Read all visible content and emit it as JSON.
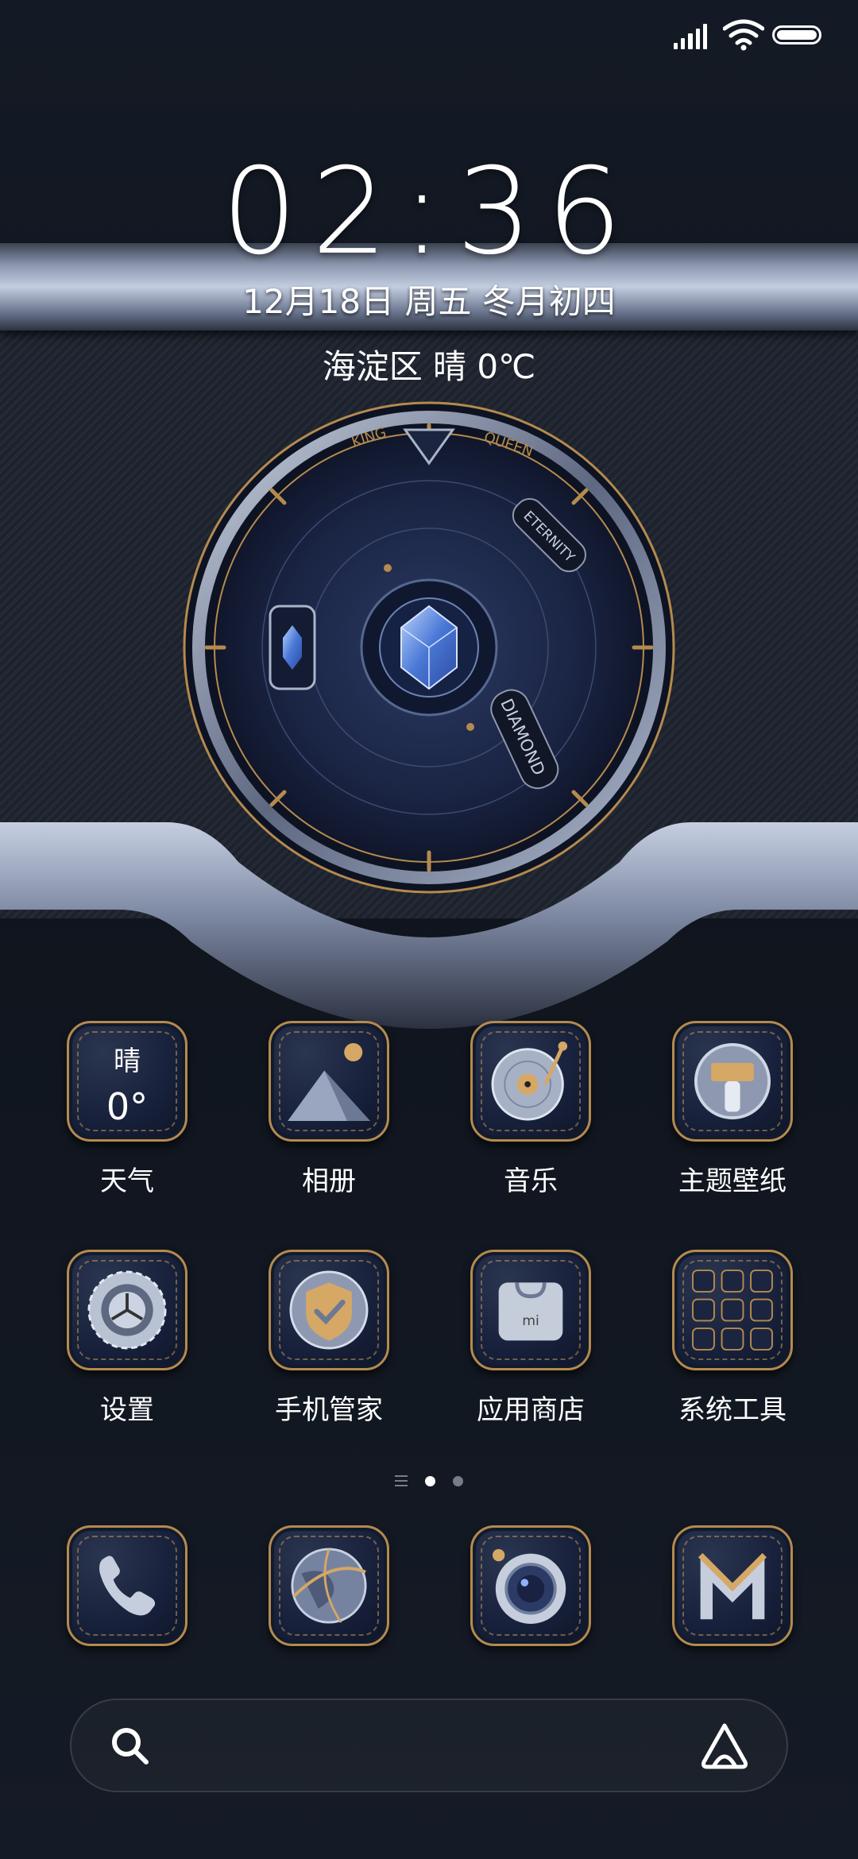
{
  "clock": {
    "time": "02:36"
  },
  "date_line": "12月18日 周五 冬月初四",
  "weather_line": "海淀区  晴  0℃",
  "dial": {
    "labels": [
      "KING",
      "QUEEN",
      "ETERNITY",
      "DIAMOND"
    ]
  },
  "apps": [
    {
      "name": "天气",
      "icon": "weather-icon",
      "text_top": "晴",
      "text_bottom": "0°"
    },
    {
      "name": "相册",
      "icon": "gallery-icon"
    },
    {
      "name": "音乐",
      "icon": "music-icon"
    },
    {
      "name": "主题壁纸",
      "icon": "themes-icon"
    },
    {
      "name": "设置",
      "icon": "settings-icon"
    },
    {
      "name": "手机管家",
      "icon": "security-icon"
    },
    {
      "name": "应用商店",
      "icon": "app-store-icon"
    },
    {
      "name": "系统工具",
      "icon": "system-tools-folder-icon"
    }
  ],
  "page_indicator": {
    "pages": 2,
    "current": 1
  },
  "dock": [
    {
      "icon": "phone-icon"
    },
    {
      "icon": "browser-icon"
    },
    {
      "icon": "camera-icon"
    },
    {
      "icon": "mail-icon"
    }
  ],
  "status_bar": {
    "signal_icon": "cellular-signal-icon",
    "wifi_icon": "wifi-icon",
    "battery_icon": "battery-icon",
    "battery_level": 1.0
  },
  "search": {
    "search_icon": "search-icon",
    "assistant_icon": "assistant-icon"
  },
  "colors": {
    "accent_gold": "#b48a4e",
    "background": "#141a25",
    "metal": "#9aa6bf"
  }
}
